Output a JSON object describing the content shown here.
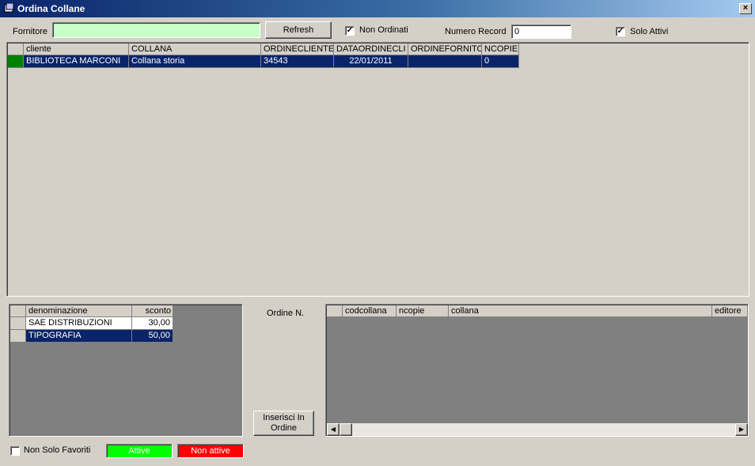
{
  "window": {
    "title": "Ordina Collane",
    "close_label": "×"
  },
  "filters": {
    "fornitore_label": "Fornitore",
    "fornitore_value": "",
    "refresh_label": "Refresh",
    "non_ordinati_label": "Non Ordinati",
    "non_ordinati_checked": true,
    "numero_record_label": "Numero Record",
    "numero_record_value": "0",
    "solo_attivi_label": "Solo Attivi",
    "solo_attivi_checked": true
  },
  "main_grid": {
    "columns": [
      "cliente",
      "COLLANA",
      "ORDINECLIENTE",
      "DATAORDINECLI",
      "ORDINEFORNITO",
      "NCOPIE"
    ],
    "rows": [
      [
        "BIBLIOTECA MARCONI",
        "Collana storia",
        "34543",
        "22/01/2011",
        "",
        "0"
      ]
    ]
  },
  "suppliers_grid": {
    "columns": [
      "denominazione",
      "sconto"
    ],
    "rows": [
      [
        "SAE DISTRIBUZIONI",
        "30,00"
      ],
      [
        "TIPOGRAFIA",
        "50,00"
      ]
    ]
  },
  "ordine": {
    "label": "Ordine N.",
    "insert_label_line1": "Inserisci In",
    "insert_label_line2": "Ordine"
  },
  "order_grid": {
    "columns": [
      "codcollana",
      "ncopie",
      "collana",
      "editore"
    ]
  },
  "legend": {
    "non_solo_favoriti_label": "Non Solo Favoriti",
    "non_solo_favoriti_checked": false,
    "attive_label": "Attive",
    "non_attive_label": "Non attive",
    "attive_color": "#00ff00",
    "non_attive_color": "#ff0000"
  },
  "scroll": {
    "left_arrow": "◀",
    "right_arrow": "▶"
  }
}
